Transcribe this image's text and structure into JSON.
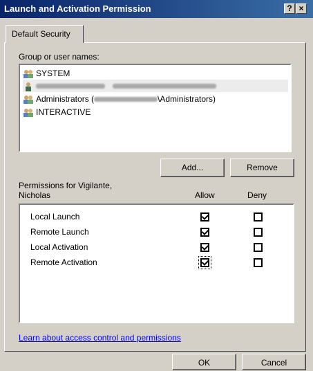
{
  "window": {
    "title": "Launch and Activation Permission",
    "help_label": "?",
    "close_label": "×"
  },
  "tab": {
    "label": "Default Security"
  },
  "groups": {
    "label": "Group or user names:",
    "items": [
      {
        "name": "SYSTEM",
        "icon": "group-icon"
      },
      {
        "name": "",
        "icon": "user-icon",
        "redacted": true
      },
      {
        "name": "Administrators (",
        "suffix": "\\Administrators)",
        "icon": "group-icon"
      },
      {
        "name": "INTERACTIVE",
        "icon": "group-icon"
      }
    ]
  },
  "buttons": {
    "add": "Add...",
    "remove": "Remove",
    "ok": "OK",
    "cancel": "Cancel"
  },
  "permissions": {
    "label_line1": "Permissions for Vigilante,",
    "label_line2": "Nicholas",
    "allow_header": "Allow",
    "deny_header": "Deny",
    "rows": [
      {
        "name": "Local Launch",
        "allow": true,
        "deny": false
      },
      {
        "name": "Remote Launch",
        "allow": true,
        "deny": false
      },
      {
        "name": "Local Activation",
        "allow": true,
        "deny": false
      },
      {
        "name": "Remote Activation",
        "allow": true,
        "deny": false
      }
    ]
  },
  "link": {
    "text": "Learn about access control and permissions"
  },
  "colors": {
    "titlebar_start": "#0a246a",
    "titlebar_end": "#3a6ea5",
    "link": "#0000ff"
  }
}
